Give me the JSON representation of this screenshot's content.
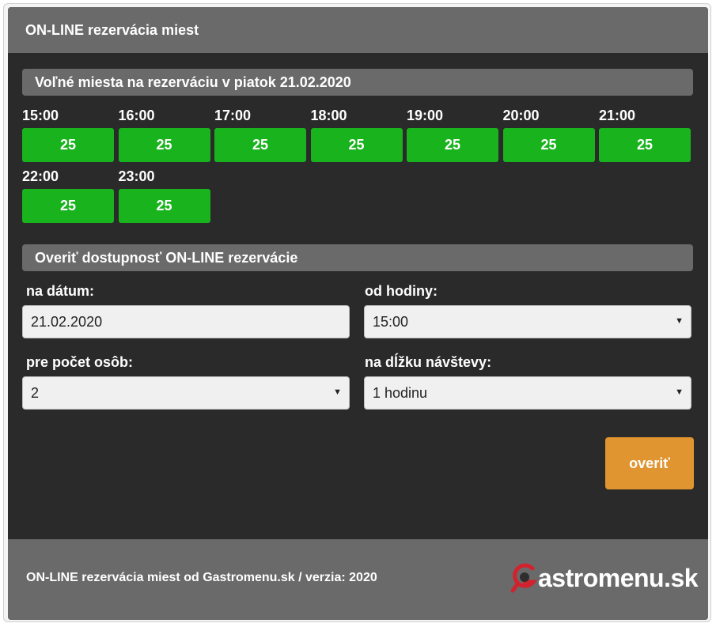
{
  "header": {
    "title": "ON-LINE rezervácia miest"
  },
  "availability": {
    "heading": "Voľné miesta na rezerváciu v piatok 21.02.2020",
    "slots": [
      {
        "time": "15:00",
        "count": "25"
      },
      {
        "time": "16:00",
        "count": "25"
      },
      {
        "time": "17:00",
        "count": "25"
      },
      {
        "time": "18:00",
        "count": "25"
      },
      {
        "time": "19:00",
        "count": "25"
      },
      {
        "time": "20:00",
        "count": "25"
      },
      {
        "time": "21:00",
        "count": "25"
      },
      {
        "time": "22:00",
        "count": "25"
      },
      {
        "time": "23:00",
        "count": "25"
      }
    ],
    "slot_color": "#19b31d"
  },
  "form": {
    "heading": "Overiť dostupnosť ON-LINE rezervácie",
    "date_label": "na dátum:",
    "date_value": "21.02.2020",
    "time_label": "od hodiny:",
    "time_value": "15:00",
    "persons_label": "pre počet osôb:",
    "persons_value": "2",
    "duration_label": "na dĺžku návštevy:",
    "duration_value": "1 hodinu",
    "submit_label": "overiť",
    "submit_color": "#e09530"
  },
  "footer": {
    "text": "ON-LINE rezervácia miest od Gastromenu.sk / verzia: 2020",
    "logo_text": "astromenu.sk",
    "logo_icon": "gastromenu-search-g-icon",
    "logo_accent_color": "#d2222d"
  }
}
